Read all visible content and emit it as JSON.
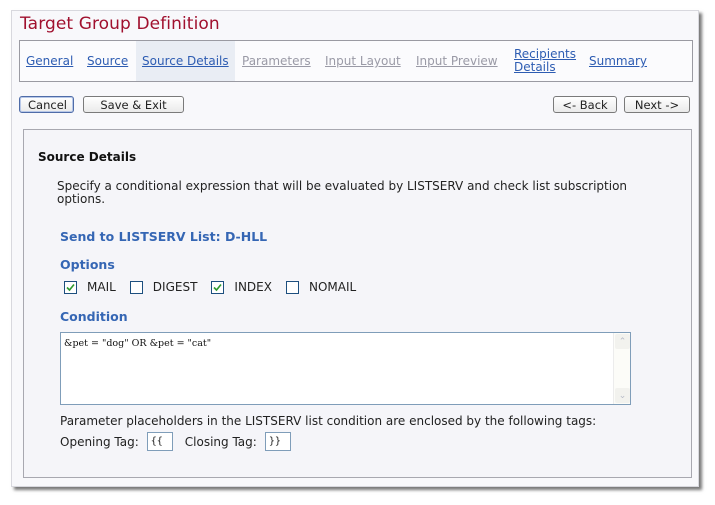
{
  "page": {
    "title": "Target Group Definition"
  },
  "tabs": [
    {
      "label": "General",
      "state": "enabled"
    },
    {
      "label": "Source",
      "state": "enabled"
    },
    {
      "label": "Source Details",
      "state": "active"
    },
    {
      "label": "Parameters",
      "state": "disabled"
    },
    {
      "label": "Input Layout",
      "state": "disabled"
    },
    {
      "label": "Input Preview",
      "state": "disabled"
    },
    {
      "label_line1": "Recipients",
      "label_line2": "Details",
      "state": "enabled"
    },
    {
      "label": "Summary",
      "state": "enabled"
    }
  ],
  "toolbar": {
    "cancel_label": "Cancel",
    "save_exit_label": "Save & Exit",
    "back_label": "<- Back",
    "next_label": "Next ->"
  },
  "section": {
    "title": "Source Details",
    "description": "Specify a conditional expression that will be evaluated by LISTSERV and check list subscription options.",
    "send_to": "Send to LISTSERV List: D-HLL",
    "options_heading": "Options",
    "options": [
      {
        "label": "MAIL",
        "checked": true
      },
      {
        "label": "DIGEST",
        "checked": false
      },
      {
        "label": "INDEX",
        "checked": true
      },
      {
        "label": "NOMAIL",
        "checked": false
      }
    ],
    "condition_heading": "Condition",
    "condition_value": "&pet = \"dog\" OR &pet = \"cat\"",
    "placeholder_note": "Parameter placeholders in the LISTSERV list condition are enclosed by the following tags:",
    "opening_tag_label": "Opening Tag:",
    "opening_tag_value": "{{",
    "closing_tag_label": "Closing Tag:",
    "closing_tag_value": "}}"
  },
  "colors": {
    "title": "#a0102e",
    "link": "#2d5cb2",
    "disabled_link": "#9a9aa6",
    "heading_blue": "#3566b4",
    "checkmark": "#2e9a2e"
  }
}
